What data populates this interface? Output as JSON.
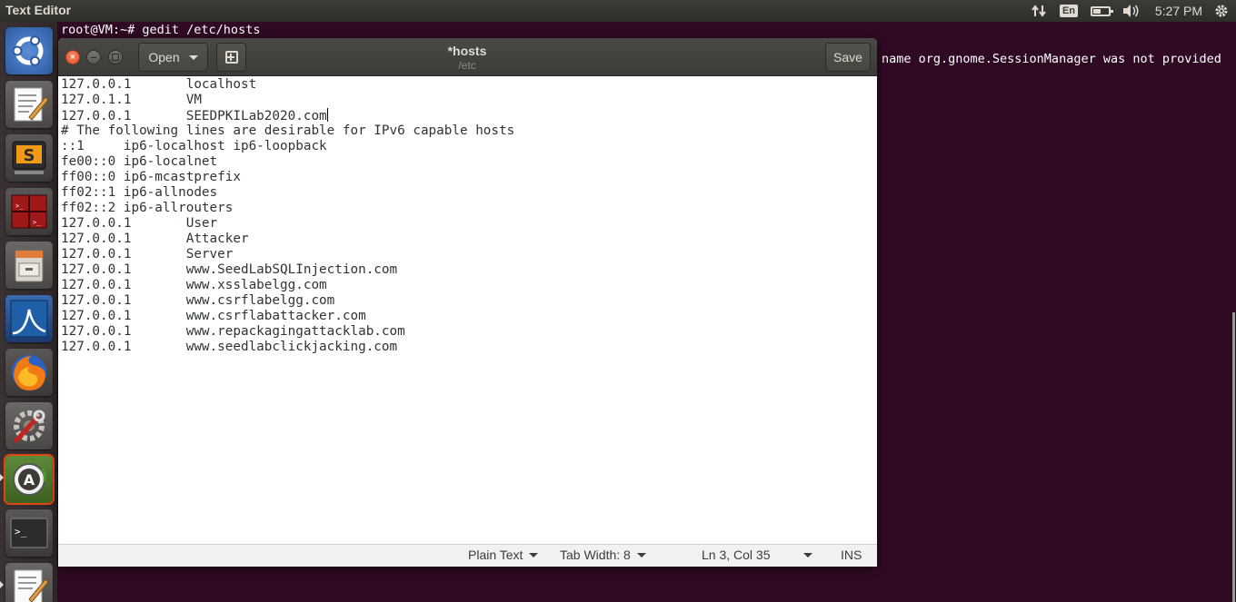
{
  "panel": {
    "app_title": "Text Editor",
    "keyboard_layout": "En",
    "clock": "5:27 PM"
  },
  "launcher": {
    "items": [
      {
        "name": "ubuntu-dash",
        "icon": "ubuntu-logo-icon"
      },
      {
        "name": "text-editor",
        "icon": "text-editor-icon"
      },
      {
        "name": "sublime-text",
        "icon": "sublime-text-icon"
      },
      {
        "name": "terminator",
        "icon": "terminator-icon"
      },
      {
        "name": "files",
        "icon": "file-cabinet-icon"
      },
      {
        "name": "wireshark",
        "icon": "wireshark-fin-icon"
      },
      {
        "name": "firefox",
        "icon": "firefox-icon"
      },
      {
        "name": "system-settings",
        "icon": "settings-tools-icon"
      },
      {
        "name": "software-updater",
        "icon": "software-updater-icon"
      },
      {
        "name": "terminal",
        "icon": "terminal-icon"
      },
      {
        "name": "text-editor-2",
        "icon": "text-editor-icon"
      }
    ]
  },
  "terminal": {
    "command_line": "root@VM:~# gedit /etc/hosts",
    "output_line": "name org.gnome.SessionManager was not provided"
  },
  "gedit": {
    "open_label": "Open",
    "save_label": "Save",
    "doc_title": "*hosts",
    "doc_path": "/etc",
    "lines": [
      "127.0.0.1       localhost",
      "127.0.1.1       VM",
      "127.0.0.1       SEEDPKILab2020.com",
      "# The following lines are desirable for IPv6 capable hosts",
      "::1     ip6-localhost ip6-loopback",
      "fe00::0 ip6-localnet",
      "ff00::0 ip6-mcastprefix",
      "ff02::1 ip6-allnodes",
      "ff02::2 ip6-allrouters",
      "127.0.0.1       User",
      "127.0.0.1       Attacker",
      "127.0.0.1       Server",
      "127.0.0.1       www.SeedLabSQLInjection.com",
      "127.0.0.1       www.xsslabelgg.com",
      "127.0.0.1       www.csrflabelgg.com",
      "127.0.0.1       www.csrflabattacker.com",
      "127.0.0.1       www.repackagingattacklab.com",
      "127.0.0.1       www.seedlabclickjacking.com"
    ],
    "status": {
      "language": "Plain Text",
      "tab_width": "Tab Width: 8",
      "position": "Ln 3, Col 35",
      "mode": "INS"
    }
  },
  "colors": {
    "desktop_bg": "#300a24",
    "close_button": "#e2511e"
  }
}
